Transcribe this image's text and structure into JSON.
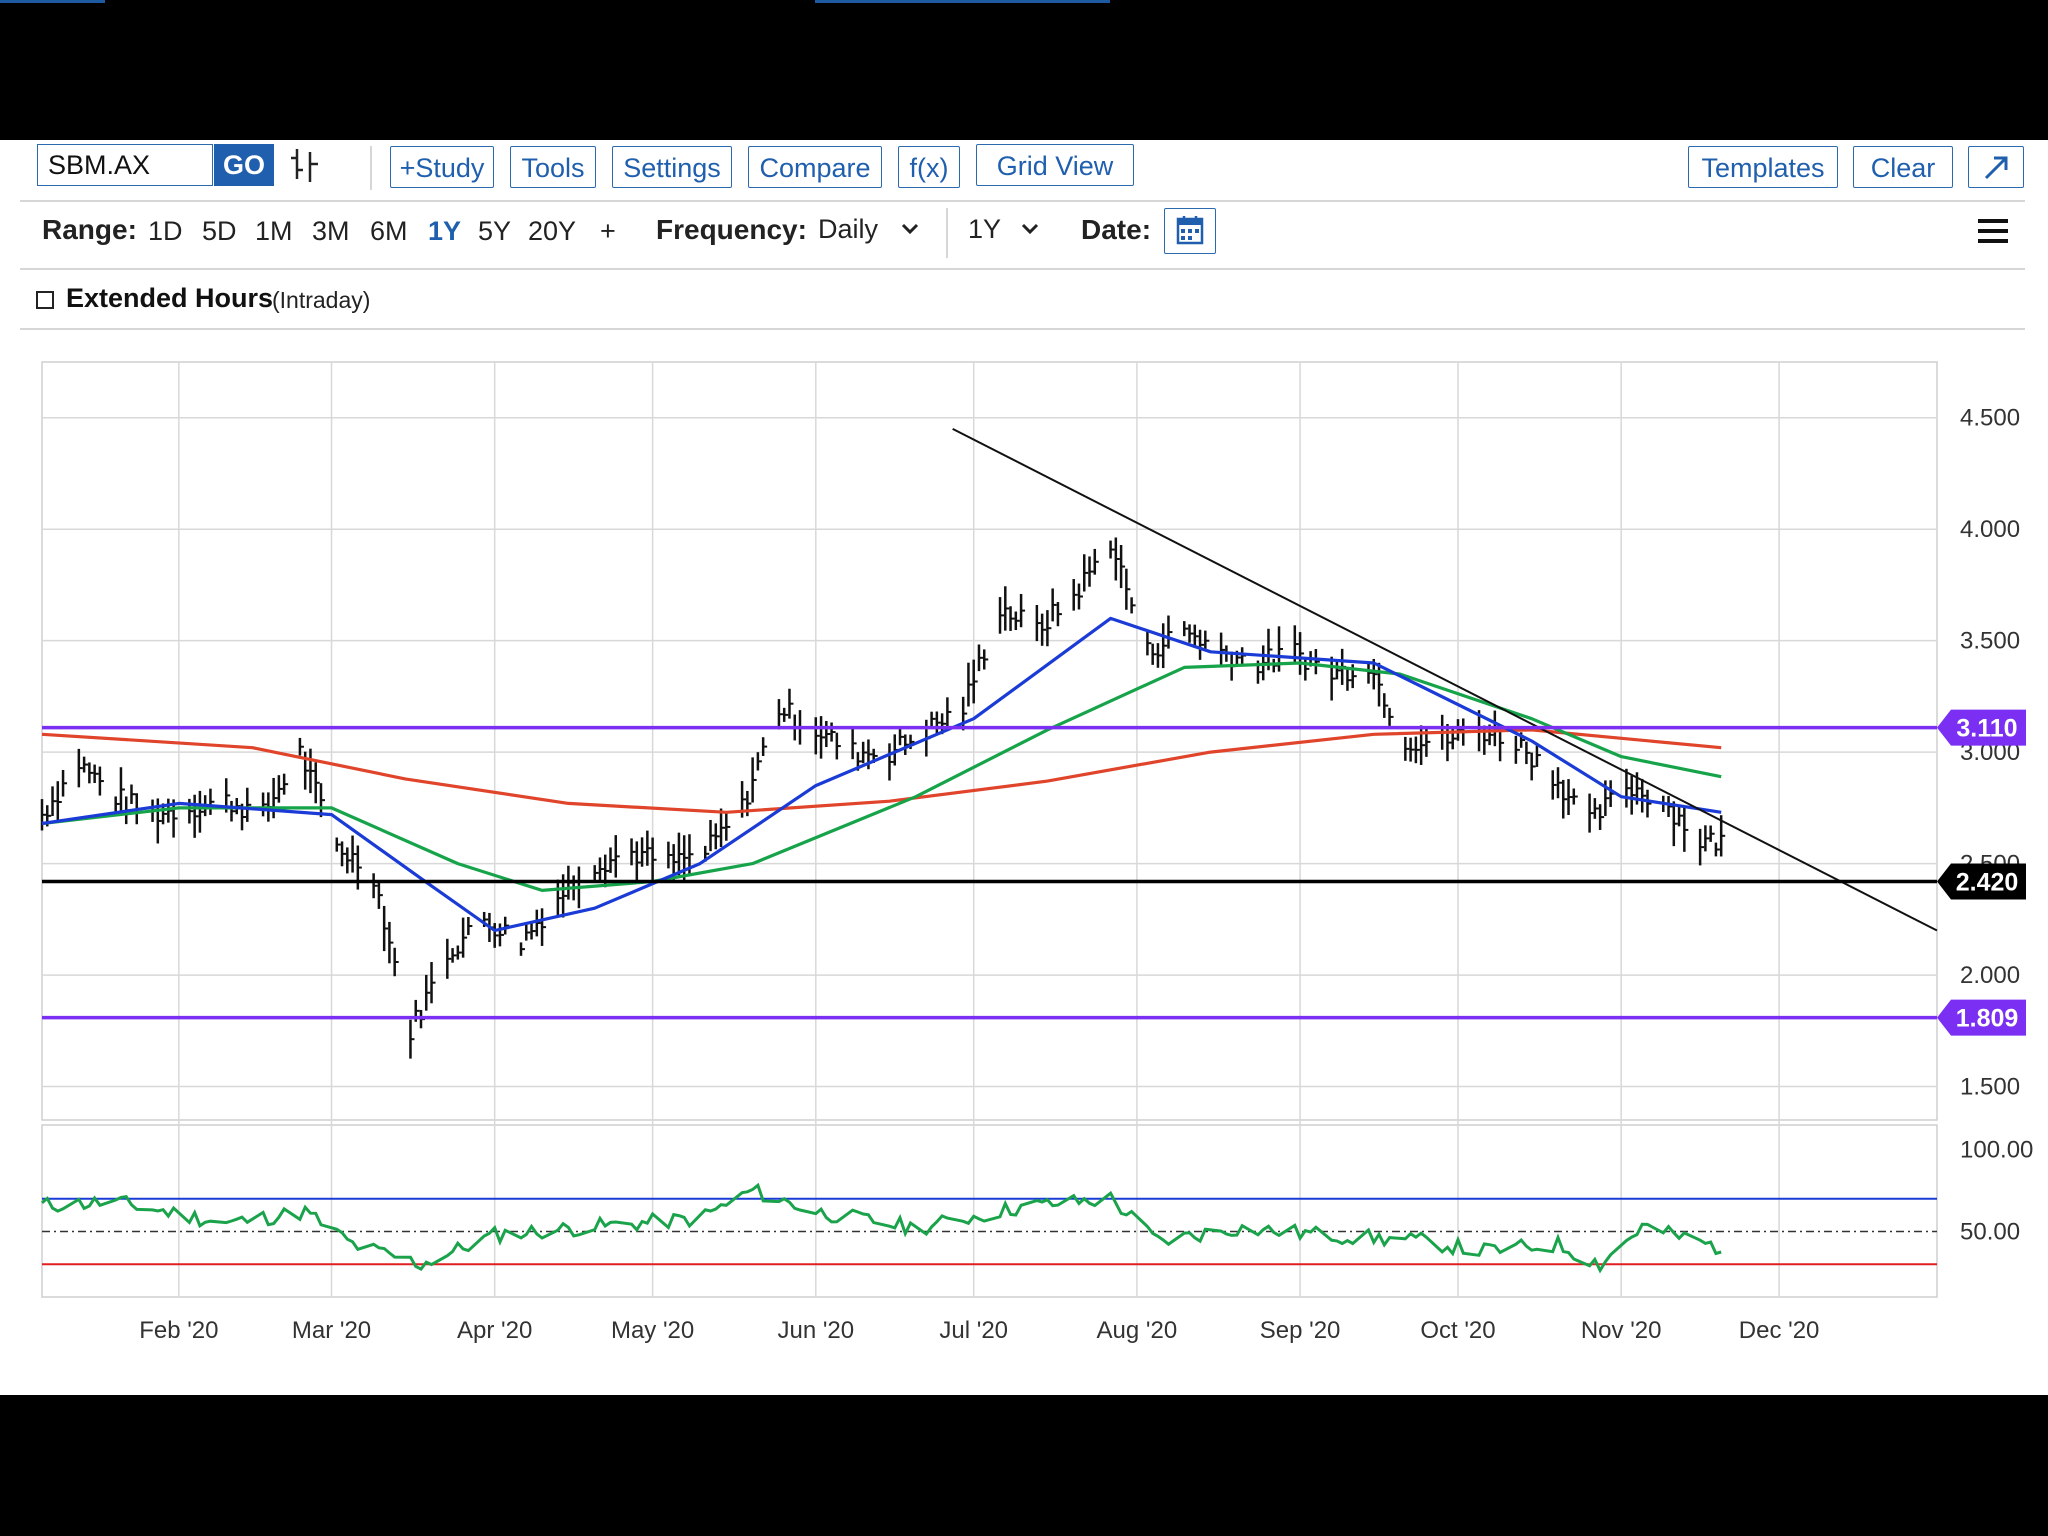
{
  "toolbar": {
    "symbol": "SBM.AX",
    "go_label": "GO",
    "study_label": "+Study",
    "tools_label": "Tools",
    "settings_label": "Settings",
    "compare_label": "Compare",
    "fx_label": "f(x)",
    "gridview_label": "Grid View",
    "templates_label": "Templates",
    "clear_label": "Clear",
    "expand_icon": "expand-arrow-icon",
    "chart_type_icon": "candlestick-icon"
  },
  "range_bar": {
    "range_label": "Range:",
    "ranges": [
      "1D",
      "5D",
      "1M",
      "3M",
      "6M",
      "1Y",
      "5Y",
      "20Y",
      "+"
    ],
    "active_range": "1Y",
    "frequency_label": "Frequency:",
    "frequency_value": "Daily",
    "period_value": "1Y",
    "date_label": "Date:",
    "calendar_icon": "calendar-icon",
    "menu_icon": "hamburger-menu-icon"
  },
  "extended_hours": {
    "label": "Extended Hours",
    "sub_label": "(Intraday)",
    "checked": false
  },
  "colors": {
    "accent": "#1f5fae",
    "sma_short": "#1a3bd6",
    "sma_mid": "#16a34a",
    "sma_long": "#e0442b",
    "level_purple": "#7b2ff2",
    "level_black": "#000000",
    "rsi_line": "#1aa34a",
    "rsi_overbought": "#1a3bd6",
    "rsi_oversold": "#e02020"
  },
  "chart_data": {
    "type": "line",
    "symbol": "SBM.AX",
    "x_ticks": [
      "Feb '20",
      "Mar '20",
      "Apr '20",
      "May '20",
      "Jun '20",
      "Jul '20",
      "Aug '20",
      "Sep '20",
      "Oct '20",
      "Nov '20",
      "Dec '20"
    ],
    "x_range": [
      "2020-01-06",
      "2020-12-31"
    ],
    "y_ticks": [
      "4.500",
      "4.000",
      "3.500",
      "3.000",
      "2.500",
      "2.000",
      "1.500"
    ],
    "ylim": [
      1.35,
      4.75
    ],
    "price_series": {
      "dates": [
        "2020-01-06",
        "2020-01-13",
        "2020-01-20",
        "2020-01-27",
        "2020-02-03",
        "2020-02-10",
        "2020-02-17",
        "2020-02-24",
        "2020-03-02",
        "2020-03-09",
        "2020-03-16",
        "2020-03-23",
        "2020-03-30",
        "2020-04-06",
        "2020-04-13",
        "2020-04-20",
        "2020-04-27",
        "2020-05-04",
        "2020-05-11",
        "2020-05-18",
        "2020-05-25",
        "2020-06-01",
        "2020-06-08",
        "2020-06-15",
        "2020-06-22",
        "2020-06-29",
        "2020-07-06",
        "2020-07-13",
        "2020-07-20",
        "2020-07-27",
        "2020-08-03",
        "2020-08-10",
        "2020-08-17",
        "2020-08-24",
        "2020-08-31",
        "2020-09-07",
        "2020-09-14",
        "2020-09-21",
        "2020-09-28",
        "2020-10-05",
        "2020-10-12",
        "2020-10-19",
        "2020-10-26",
        "2020-11-02",
        "2020-11-09",
        "2020-11-16"
      ],
      "close": [
        2.72,
        2.95,
        2.8,
        2.72,
        2.75,
        2.78,
        2.72,
        3.0,
        2.58,
        2.45,
        1.75,
        2.1,
        2.25,
        2.15,
        2.35,
        2.5,
        2.55,
        2.5,
        2.55,
        2.75,
        3.2,
        3.1,
        3.0,
        3.0,
        3.1,
        3.2,
        3.65,
        3.55,
        3.7,
        3.95,
        3.45,
        3.55,
        3.45,
        3.4,
        3.45,
        3.35,
        3.4,
        3.05,
        3.05,
        3.1,
        3.05,
        2.9,
        2.68,
        2.85,
        2.78,
        2.6
      ]
    },
    "sma_short": {
      "dates": [
        "2020-01-06",
        "2020-02-01",
        "2020-03-01",
        "2020-03-20",
        "2020-04-01",
        "2020-04-20",
        "2020-05-10",
        "2020-06-01",
        "2020-07-01",
        "2020-07-27",
        "2020-08-15",
        "2020-09-15",
        "2020-10-15",
        "2020-11-01",
        "2020-11-20"
      ],
      "values": [
        2.68,
        2.77,
        2.72,
        2.4,
        2.2,
        2.3,
        2.5,
        2.85,
        3.15,
        3.6,
        3.45,
        3.4,
        3.05,
        2.8,
        2.73
      ]
    },
    "sma_mid": {
      "dates": [
        "2020-01-06",
        "2020-02-01",
        "2020-03-01",
        "2020-03-25",
        "2020-04-10",
        "2020-05-01",
        "2020-05-20",
        "2020-06-20",
        "2020-07-15",
        "2020-08-10",
        "2020-09-01",
        "2020-09-20",
        "2020-10-15",
        "2020-11-01",
        "2020-11-20"
      ],
      "values": [
        2.68,
        2.75,
        2.75,
        2.5,
        2.38,
        2.42,
        2.5,
        2.8,
        3.1,
        3.38,
        3.4,
        3.35,
        3.15,
        2.98,
        2.89
      ]
    },
    "sma_long": {
      "dates": [
        "2020-01-06",
        "2020-02-15",
        "2020-03-15",
        "2020-04-15",
        "2020-05-15",
        "2020-06-15",
        "2020-07-15",
        "2020-08-15",
        "2020-09-15",
        "2020-10-15",
        "2020-11-20"
      ],
      "values": [
        3.08,
        3.02,
        2.88,
        2.77,
        2.73,
        2.78,
        2.87,
        3.0,
        3.08,
        3.1,
        3.02
      ]
    },
    "trendline": {
      "start": [
        "2020-06-27",
        4.45
      ],
      "end": [
        "2020-12-31",
        2.2
      ]
    },
    "levels": [
      {
        "value": 3.11,
        "label": "3.110",
        "color": "#7b2ff2"
      },
      {
        "value": 2.42,
        "label": "2.420",
        "color": "#000000"
      },
      {
        "value": 1.809,
        "label": "1.809",
        "color": "#7b2ff2"
      }
    ],
    "rsi": {
      "y_ticks": [
        "100.00",
        "50.00"
      ],
      "ylim": [
        10,
        115
      ],
      "overbought": 70,
      "midline": 50,
      "oversold": 30,
      "dates": [
        "2020-01-06",
        "2020-01-20",
        "2020-02-10",
        "2020-02-25",
        "2020-03-05",
        "2020-03-18",
        "2020-04-01",
        "2020-04-20",
        "2020-05-10",
        "2020-05-20",
        "2020-06-01",
        "2020-06-20",
        "2020-07-10",
        "2020-07-27",
        "2020-08-05",
        "2020-08-20",
        "2020-09-10",
        "2020-09-25",
        "2020-10-05",
        "2020-10-20",
        "2020-10-28",
        "2020-11-05",
        "2020-11-20"
      ],
      "values": [
        66,
        68,
        55,
        62,
        42,
        30,
        48,
        53,
        58,
        75,
        62,
        52,
        65,
        70,
        44,
        52,
        47,
        44,
        38,
        42,
        30,
        53,
        40
      ]
    }
  }
}
